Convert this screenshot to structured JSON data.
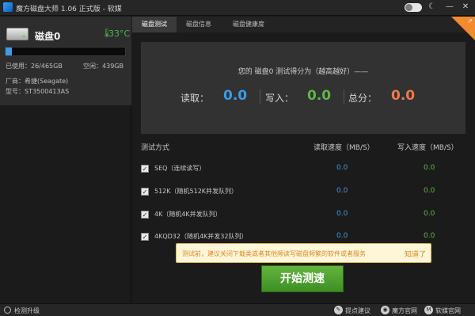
{
  "window": {
    "title": "魔方磁盘大师 1.06 正式版 - 软媒",
    "minimize": "—",
    "close": "✕"
  },
  "disk": {
    "name": "磁盘0",
    "temperature": "33°C",
    "used": "已使用：26/465GB",
    "free": "空闲：439GB",
    "usage_fraction": 0.056,
    "vendor": "厂商：希捷(Seagate)",
    "model": "型号：ST3500413AS"
  },
  "tabs": [
    {
      "label": "磁盘测试",
      "active": true
    },
    {
      "label": "磁盘信息",
      "active": false
    },
    {
      "label": "磁盘健康度",
      "active": false
    }
  ],
  "score": {
    "headline": "您的 磁盘0 测试得分为（越高越好）——",
    "read_label": "读取：",
    "read_value": "0.0",
    "write_label": "写入：",
    "write_value": "0.0",
    "total_label": "总分：",
    "total_value": "0.0",
    "colors": {
      "read": "#3a9de6",
      "write": "#5fb54a",
      "total": "#ef7a48"
    }
  },
  "table": {
    "headers": [
      "测试方式",
      "读取速度（MB/S）",
      "写入速度（MB/S）"
    ],
    "rows": [
      {
        "checked": true,
        "label": "SEQ（连续读写）",
        "read": "0.0",
        "write": "0.0"
      },
      {
        "checked": true,
        "label": "512K（随机512K并发队列）",
        "read": "0.0",
        "write": "0.0"
      },
      {
        "checked": true,
        "label": "4K（随机4K并发队列）",
        "read": "0.0",
        "write": "0.0"
      },
      {
        "checked": true,
        "label": "4KQD32（随机4K并发32队列）",
        "read": "0.0",
        "write": "0.0"
      }
    ]
  },
  "notice": {
    "text": "测试前，建议关闭下载类或者其他频读写磁盘频繁的软件或者服务",
    "dismiss": "知道了"
  },
  "start_button": "开始测速",
  "status": {
    "update": "检测升级",
    "links": [
      {
        "icon": "feedback-icon",
        "label": "提点建议"
      },
      {
        "icon": "mofang-icon",
        "label": "魔方官网"
      },
      {
        "icon": "ruanmei-icon",
        "label": "软媒官网"
      }
    ]
  }
}
